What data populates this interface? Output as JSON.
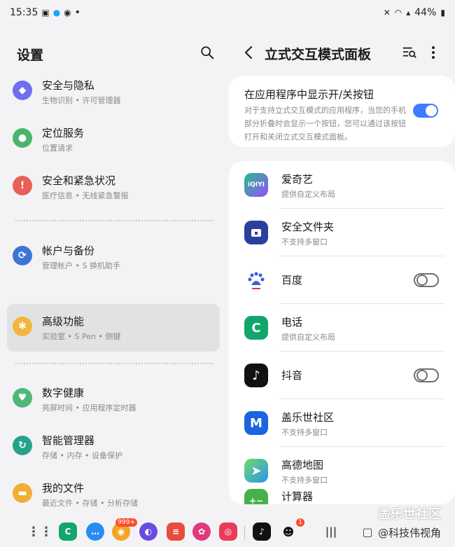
{
  "status_bar": {
    "time": "15:35",
    "dot": "•",
    "battery": "44%"
  },
  "left": {
    "title": "设置",
    "items": [
      {
        "title": "安全与隐私",
        "sub": "生物识别 • 许可管理器",
        "color": "#6f6ef2",
        "icon": "shield-icon",
        "glyph": "◆"
      },
      {
        "title": "定位服务",
        "sub": "位置请求",
        "color": "#4ab56b",
        "icon": "location-icon",
        "glyph": "●"
      },
      {
        "title": "安全和紧急状况",
        "sub": "医疗信息 • 无线紧急警报",
        "color": "#ea5f56",
        "icon": "emergency-icon",
        "glyph": "!"
      },
      {
        "title": "帐户与备份",
        "sub": "管理帐户 • S 换机助手",
        "color": "#3b75d6",
        "icon": "sync-icon",
        "glyph": "⟳"
      },
      {
        "title": "高级功能",
        "sub": "实验室 • S Pen • 侧键",
        "color": "#f1b63b",
        "icon": "advanced-gear-icon",
        "glyph": "✱"
      },
      {
        "title": "数字健康",
        "sub": "亮屏时间 • 应用程序定时器",
        "color": "#4fb878",
        "icon": "wellbeing-icon",
        "glyph": "♥"
      },
      {
        "title": "智能管理器",
        "sub": "存储 • 内存 • 设备保护",
        "color": "#25a38a",
        "icon": "care-icon",
        "glyph": "↻"
      },
      {
        "title": "我的文件",
        "sub": "最近文件 • 存储 • 分析存储",
        "color": "#f0ae33",
        "icon": "folder-icon",
        "glyph": "▬"
      }
    ]
  },
  "right": {
    "title": "立式交互模式面板",
    "toggle_card": {
      "title": "在应用程序中显示开/关按钮",
      "desc": "对于支持立式交互模式的应用程序，当您的手机部分折叠时会显示一个按钮，您可以通过该按钮打开和关闭立式交互模式面板。"
    },
    "apps": [
      {
        "title": "爱奇艺",
        "sub": "提供自定义布局",
        "color": "#21c08b",
        "icon": "iqiyi-icon",
        "glyph": "iQIYI",
        "toggle": null
      },
      {
        "title": "安全文件夹",
        "sub": "不支持多窗口",
        "color": "#2d3f9c",
        "icon": "secure-folder-icon",
        "glyph": "🔒",
        "toggle": null
      },
      {
        "title": "百度",
        "sub": "",
        "color": "#ffffff",
        "icon": "baidu-icon",
        "glyph": "du",
        "toggle": "off"
      },
      {
        "title": "电话",
        "sub": "提供自定义布局",
        "color": "#12a66b",
        "icon": "phone-icon",
        "glyph": "C",
        "toggle": null
      },
      {
        "title": "抖音",
        "sub": "",
        "color": "#111111",
        "icon": "douyin-icon",
        "glyph": "♪",
        "toggle": "off"
      },
      {
        "title": "盖乐世社区",
        "sub": "不支持多窗口",
        "color": "#1b64e0",
        "icon": "members-icon",
        "glyph": "M",
        "toggle": null
      },
      {
        "title": "高德地图",
        "sub": "不支持多窗口",
        "color": "#2a95ee",
        "icon": "amap-icon",
        "glyph": "➤",
        "toggle": null
      },
      {
        "title": "计算器",
        "sub": "",
        "color": "#47b04b",
        "icon": "calculator-icon",
        "glyph": "+−",
        "toggle": null
      }
    ]
  },
  "dock": {
    "badge1": "999+",
    "badge2": "1"
  },
  "watermark": {
    "line1": "盖乐世社区",
    "line2": "@科技伟视角"
  }
}
